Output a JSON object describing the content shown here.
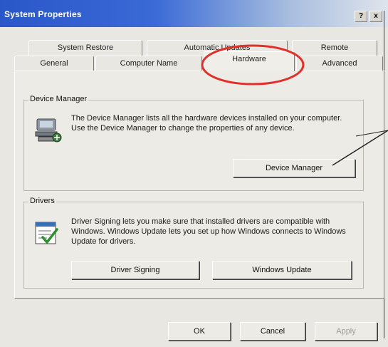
{
  "window": {
    "title": "System Properties",
    "help_label": "?",
    "close_label": "x"
  },
  "tabs": {
    "row1": [
      {
        "label": "System Restore"
      },
      {
        "label": "Automatic Updates"
      },
      {
        "label": "Remote"
      }
    ],
    "row2": [
      {
        "label": "General"
      },
      {
        "label": "Computer Name"
      },
      {
        "label": "Hardware",
        "active": true
      },
      {
        "label": "Advanced"
      }
    ]
  },
  "device_manager": {
    "group_title": "Device Manager",
    "description": "The Device Manager lists all the hardware devices installed on your computer. Use the Device Manager to change the properties of any device.",
    "button_label": "Device Manager"
  },
  "drivers": {
    "group_title": "Drivers",
    "description": "Driver Signing lets you make sure that installed drivers are compatible with Windows. Windows Update lets you set up how Windows connects to Windows Update for drivers.",
    "driver_signing_label": "Driver Signing",
    "windows_update_label": "Windows Update"
  },
  "footer": {
    "ok_label": "OK",
    "cancel_label": "Cancel",
    "apply_label": "Apply"
  },
  "colors": {
    "annotation": "#e0302a",
    "titlebar": "#2a57c8",
    "face": "#e9e7e1"
  },
  "icons": [
    "device-manager-icon",
    "driver-signing-icon",
    "help-icon",
    "close-icon"
  ]
}
